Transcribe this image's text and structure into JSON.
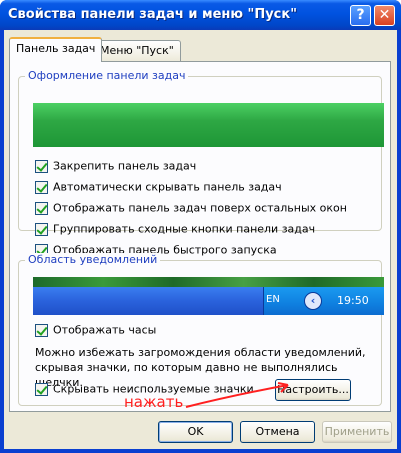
{
  "window": {
    "title": "Свойства панели задач и меню \"Пуск\"",
    "help_glyph": "?",
    "close_glyph": "✕"
  },
  "tabs": [
    {
      "label": "Панель задач",
      "active": true
    },
    {
      "label": "Меню \"Пуск\"",
      "active": false
    }
  ],
  "taskbar_group": {
    "title": "Оформление панели задач",
    "options": [
      {
        "label": "Закрепить панель задач",
        "checked": true
      },
      {
        "label": "Автоматически скрывать панель задач",
        "checked": true
      },
      {
        "label": "Отображать панель задач поверх остальных окон",
        "checked": true
      },
      {
        "label": "Группировать сходные кнопки панели задач",
        "checked": true
      },
      {
        "label": "Отображать панель быстрого запуска",
        "checked": true
      }
    ]
  },
  "notify_group": {
    "title": "Область уведомлений",
    "tray_lang": "EN",
    "tray_arrow": "‹",
    "tray_clock": "19:50",
    "show_clock_label": "Отображать часы",
    "info": "Можно избежать загромождения области уведомлений, скрывая значки, по которым давно не выполнялись щелчки.",
    "hide_icons_label": "Скрывать неиспользуемые значки",
    "customize_button": "Настроить..."
  },
  "annotation": "нажать",
  "colors": {
    "annotation": "#ff2020",
    "titlebar": "#0052e0",
    "group_title": "#1f3fc0"
  },
  "footer": {
    "ok": "OK",
    "cancel": "Отмена",
    "apply": "Применить"
  }
}
